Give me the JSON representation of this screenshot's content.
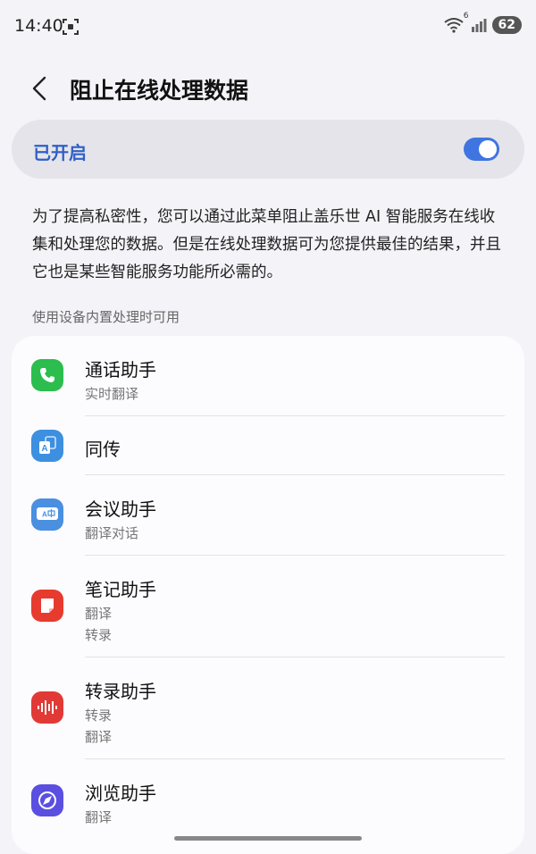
{
  "status_bar": {
    "time": "14:40",
    "battery": "62",
    "wifi_badge": "6"
  },
  "header": {
    "title": "阻止在线处理数据"
  },
  "master_switch": {
    "label": "已开启",
    "on": true,
    "accent": "#3f75e0"
  },
  "description": "为了提高私密性，您可以通过此菜单阻止盖乐世 AI 智能服务在线收集和处理您的数据。但是在线处理数据可为您提供最佳的结果，并且它也是某些智能服务功能所必需的。",
  "section_label": "使用设备内置处理时可用",
  "apps": [
    {
      "title": "通话助手",
      "subs": [
        "实时翻译"
      ],
      "icon": "phone-icon",
      "color": "#2bbd4e"
    },
    {
      "title": "同传",
      "subs": [],
      "icon": "interpreter-icon",
      "color": "#3d8fe0"
    },
    {
      "title": "会议助手",
      "subs": [
        "翻译对话"
      ],
      "icon": "translate-icon",
      "color": "#4a8fe0"
    },
    {
      "title": "笔记助手",
      "subs": [
        "翻译",
        "转录"
      ],
      "icon": "notes-icon",
      "color": "#e63b2e"
    },
    {
      "title": "转录助手",
      "subs": [
        "转录",
        "翻译"
      ],
      "icon": "voice-recorder-icon",
      "color": "#e13a36"
    },
    {
      "title": "浏览助手",
      "subs": [
        "翻译"
      ],
      "icon": "browser-icon",
      "color": "#5a4fe0"
    }
  ]
}
